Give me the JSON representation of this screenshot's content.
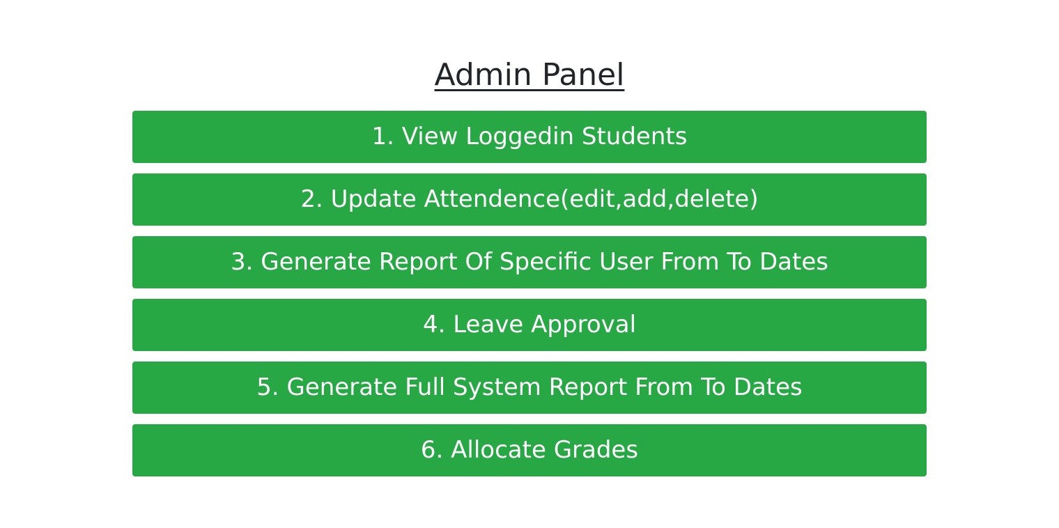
{
  "page": {
    "title": "Admin Panel"
  },
  "menu": {
    "items": [
      {
        "label": "1. View Loggedin Students"
      },
      {
        "label": "2. Update Attendence(edit,add,delete)"
      },
      {
        "label": "3. Generate Report Of Specific User From To Dates"
      },
      {
        "label": "4. Leave Approval"
      },
      {
        "label": "5. Generate Full System Report From To Dates"
      },
      {
        "label": "6. Allocate Grades"
      }
    ]
  },
  "colors": {
    "button_background": "#28a745",
    "button_text": "#ffffff",
    "title_text": "#212529",
    "page_background": "#ffffff"
  }
}
